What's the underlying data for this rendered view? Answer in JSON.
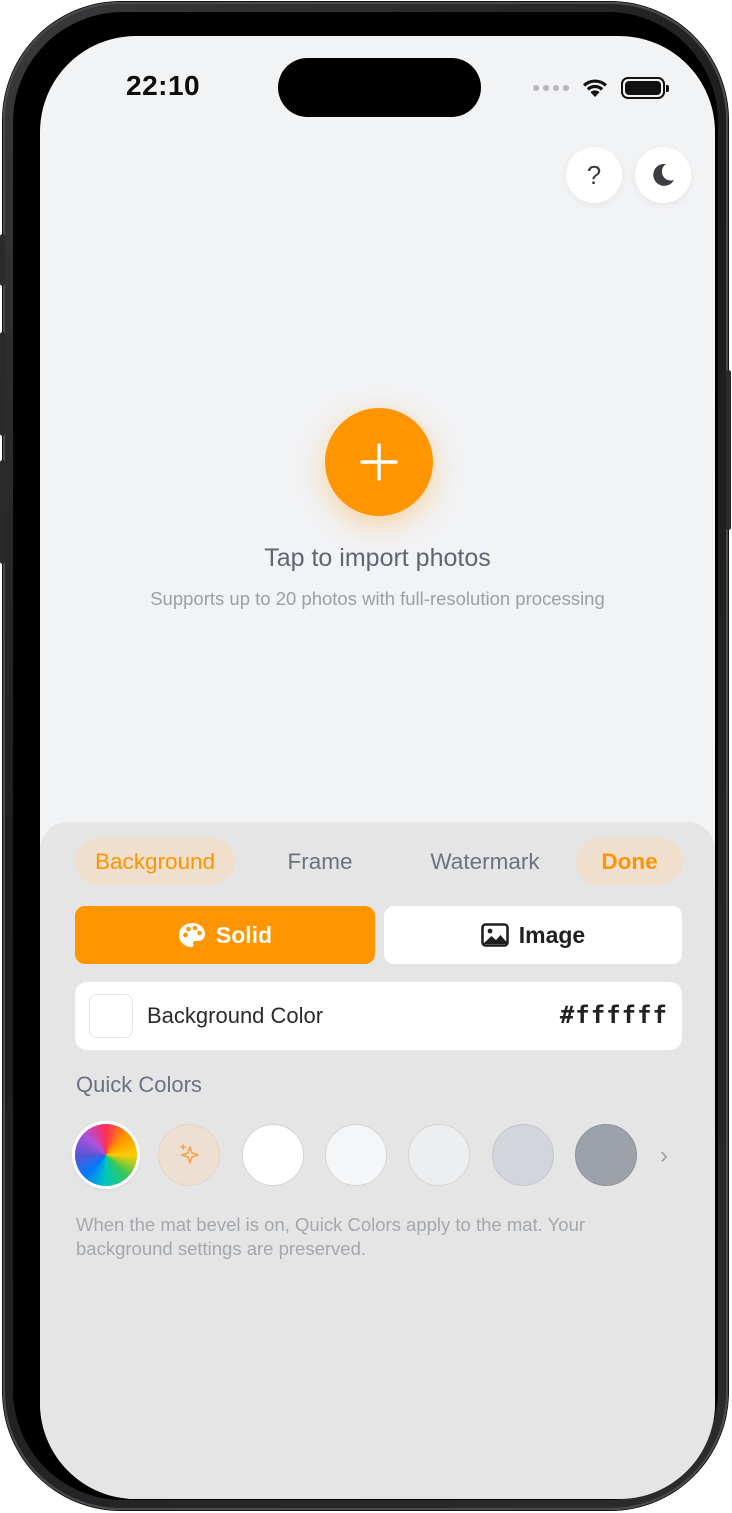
{
  "status_bar": {
    "time": "22:10"
  },
  "top_buttons": {
    "help_label": "?"
  },
  "import": {
    "title": "Tap to import photos",
    "subtitle": "Supports up to 20 photos with full-resolution processing"
  },
  "sheet": {
    "tabs": [
      {
        "label": "Background",
        "active": true
      },
      {
        "label": "Frame",
        "active": false
      },
      {
        "label": "Watermark",
        "active": false
      }
    ],
    "done_label": "Done",
    "segments": {
      "solid_label": "Solid",
      "image_label": "Image",
      "selected": "Solid"
    },
    "background_color": {
      "label": "Background Color",
      "value": "#ffffff"
    },
    "quick_colors": {
      "title": "Quick Colors",
      "swatches": [
        "rainbow-picker",
        "auto-sparkle",
        "#ffffff",
        "#f5f6f8",
        "#edeef0",
        "#d2d5db",
        "#9ca1aa"
      ]
    },
    "note": "When the mat bevel is on, Quick Colors apply to the mat. Your background settings are preserved."
  },
  "colors": {
    "accent": "#ff9500",
    "accent_soft": "#f0dfcd",
    "sheet_bg": "#e5e5e5",
    "screen_bg": "#f2f3f5"
  }
}
